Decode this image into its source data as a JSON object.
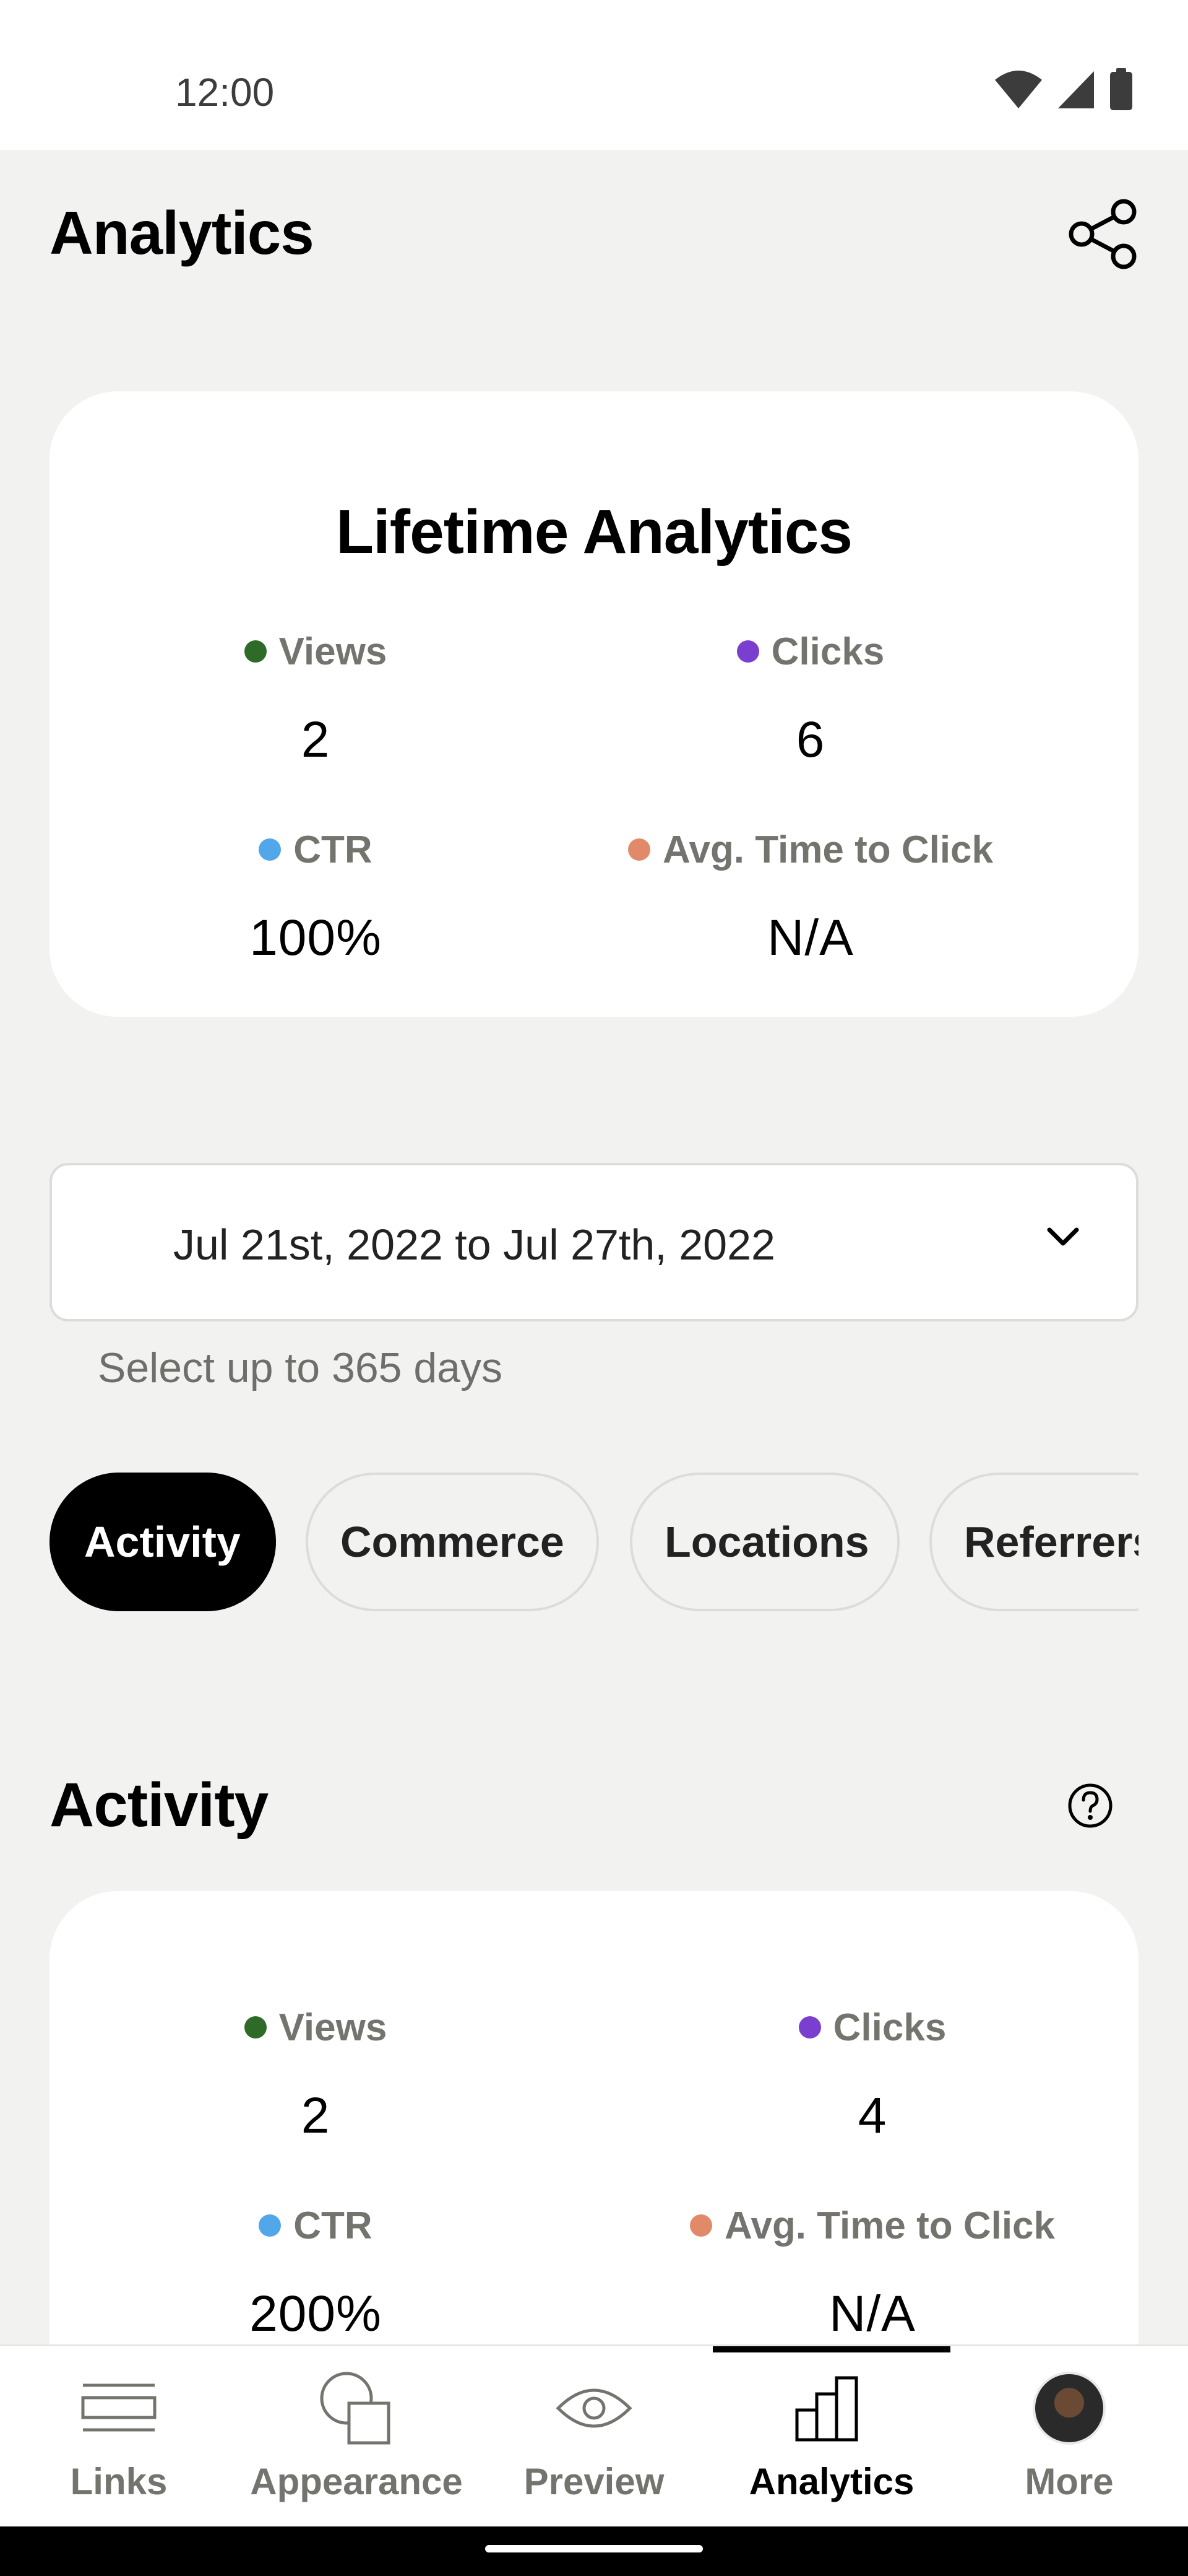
{
  "status_bar": {
    "time": "12:00",
    "icons": [
      "wifi-icon",
      "signal-icon",
      "battery-icon"
    ]
  },
  "header": {
    "title": "Analytics",
    "share_icon": "share-icon"
  },
  "lifetime": {
    "title": "Lifetime Analytics",
    "metrics": [
      {
        "label": "Views",
        "value": "2",
        "color": "#2e6b28"
      },
      {
        "label": "Clicks",
        "value": "6",
        "color": "#7b3fcf"
      },
      {
        "label": "CTR",
        "value": "100%",
        "color": "#52a6ea"
      },
      {
        "label": "Avg. Time to Click",
        "value": "N/A",
        "color": "#e08a6a"
      }
    ]
  },
  "date_range": {
    "value": "Jul 21st, 2022 to Jul 27th, 2022",
    "hint": "Select up to 365 days"
  },
  "tabs": [
    {
      "label": "Activity",
      "active": true
    },
    {
      "label": "Commerce",
      "active": false
    },
    {
      "label": "Locations",
      "active": false
    },
    {
      "label": "Referrers",
      "active": false
    }
  ],
  "activity": {
    "title": "Activity",
    "help_icon": "help-icon",
    "metrics": [
      {
        "label": "Views",
        "value": "2",
        "color": "#2e6b28"
      },
      {
        "label": "Clicks",
        "value": "4",
        "color": "#7b3fcf"
      },
      {
        "label": "CTR",
        "value": "200%",
        "color": "#52a6ea"
      },
      {
        "label": "Avg. Time to Click",
        "value": "N/A",
        "color": "#e08a6a"
      }
    ]
  },
  "bottom_nav": {
    "items": [
      {
        "label": "Links",
        "icon": "links-icon",
        "active": false
      },
      {
        "label": "Appearance",
        "icon": "appearance-icon",
        "active": false
      },
      {
        "label": "Preview",
        "icon": "eye-icon",
        "active": false
      },
      {
        "label": "Analytics",
        "icon": "bar-chart-icon",
        "active": true
      },
      {
        "label": "More",
        "icon": "avatar",
        "active": false
      }
    ]
  },
  "colors": {
    "background": "#f2f2f1",
    "card": "#ffffff",
    "active_tab": "#000000",
    "muted_text": "#74746f"
  }
}
